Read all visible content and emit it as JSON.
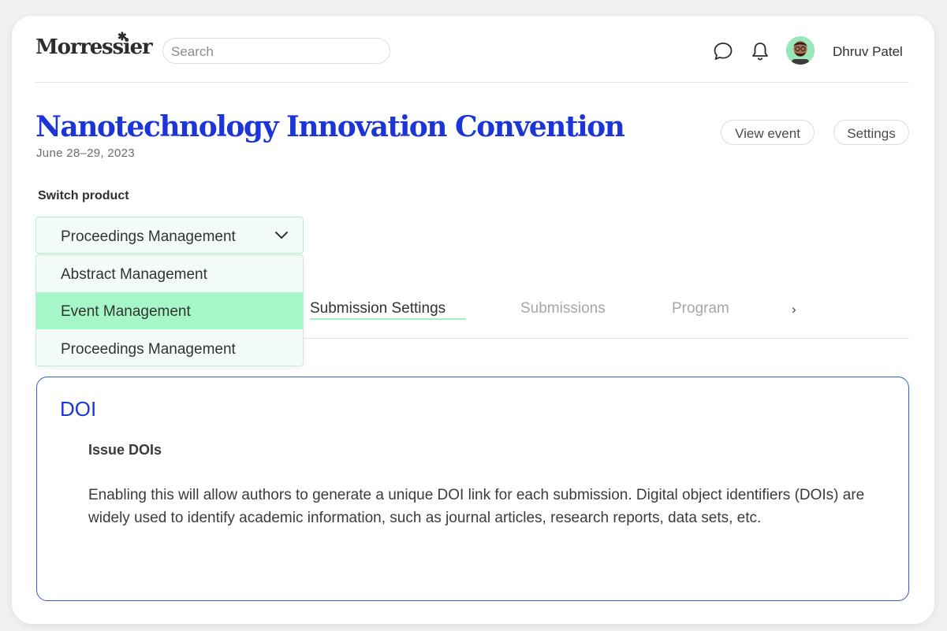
{
  "header": {
    "logo_text": "Morressier",
    "search_placeholder": "Search",
    "user_name": "Dhruv Patel",
    "icons": [
      "chat-icon",
      "bell-icon"
    ],
    "avatar_bg": "#9ae7bb"
  },
  "event": {
    "title": "Nanotechnology Innovation Convention",
    "date": "June 28–29, 2023",
    "view_event_label": "View event",
    "settings_label": "Settings"
  },
  "product_switch": {
    "label": "Switch product",
    "selected": "Proceedings Management",
    "options": [
      {
        "label": "Abstract Management",
        "highlighted": false
      },
      {
        "label": "Event Management",
        "highlighted": true
      },
      {
        "label": "Proceedings Management",
        "highlighted": false
      }
    ]
  },
  "tabs": [
    {
      "label": "Submission Settings",
      "active": true
    },
    {
      "label": "Submissions",
      "active": false
    },
    {
      "label": "Program",
      "active": false
    }
  ],
  "tabs_more": "›",
  "doi": {
    "title": "DOI",
    "subtitle": "Issue DOIs",
    "description": "Enabling this will allow authors to generate a unique DOI link for each submission. Digital object identifiers (DOIs) are widely used to identify academic information, such as journal articles, research reports, data sets, etc."
  },
  "colors": {
    "brand_blue": "#1c35d6",
    "mint_highlight": "#a6f7c8",
    "mint_bg": "#f3fbf6"
  }
}
